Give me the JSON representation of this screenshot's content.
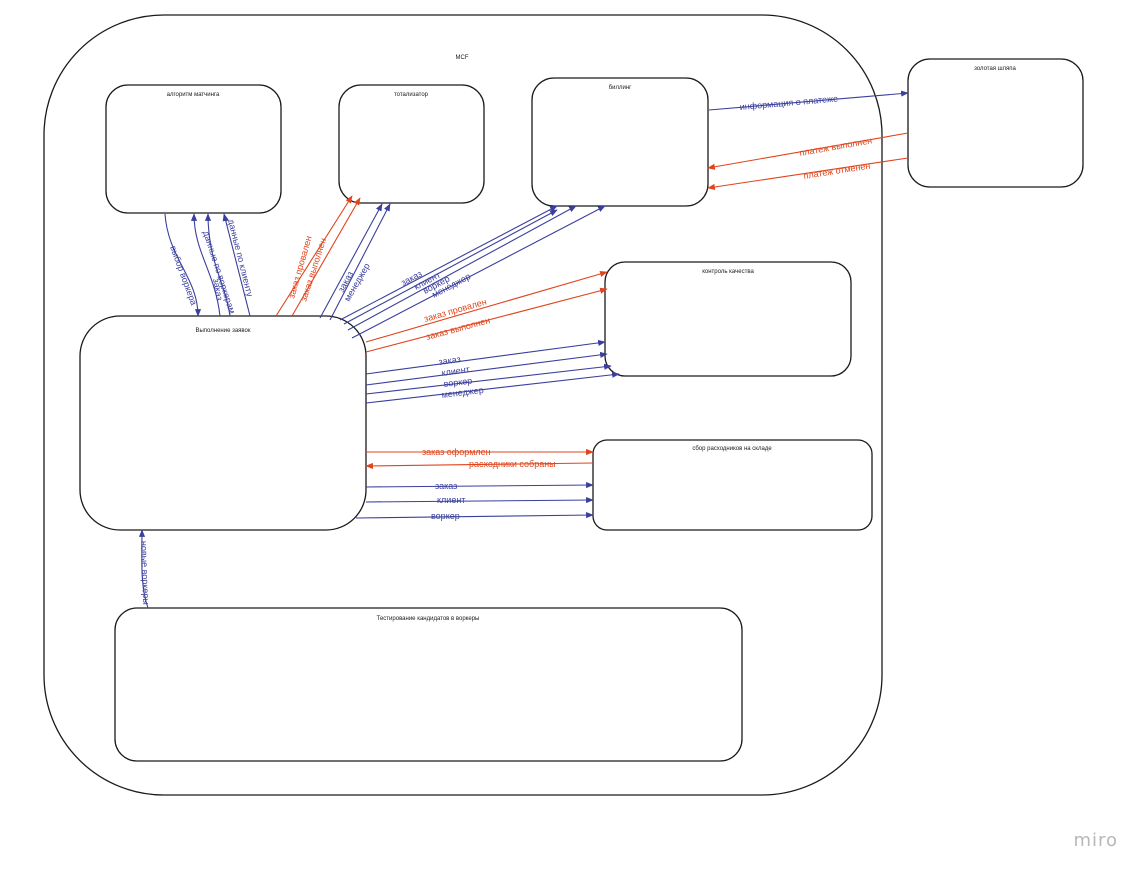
{
  "colors": {
    "blue": "#3a3f9c",
    "red": "#e0441c",
    "border": "#1a1a1a",
    "logo": "#b8b8b8"
  },
  "brand": {
    "logo_text": "miro"
  },
  "container": {
    "label": "МСF"
  },
  "nodes": {
    "matching": "алгоритм матчинга",
    "totalizator": "тотализатор",
    "billing": "биллинг",
    "golden_hat": "золотая шляпа",
    "orders": "Выполнение заявок",
    "quality": "контроль качества",
    "warehouse": "сбор расходников на складе",
    "testing": "Тестирование кандидатов в воркеры"
  },
  "edges": {
    "worker_pick": "выбор воркера",
    "worker_data": "данные по воркерам",
    "order_to_matching": "заказ",
    "client_data": "данные по клиенту",
    "tot_failed": "заказ провален",
    "tot_done": "заказ выполнен",
    "tot_order": "заказ",
    "tot_manager": "менеджер",
    "bill_order": "заказ",
    "bill_client": "клиент",
    "bill_worker": "воркер",
    "bill_manager": "менеджер",
    "payment_info": "информация о платеже",
    "payment_done": "платеж выполнен",
    "payment_cancelled": "платеж отменен",
    "qc_failed": "заказ провален",
    "qc_done": "заказ выполнен",
    "qc_order": "заказ",
    "qc_client": "клиент",
    "qc_worker": "воркер",
    "qc_manager": "менеджер",
    "wh_order_placed": "заказ оформлен",
    "wh_supplies": "расходники собраны",
    "wh_order": "заказ",
    "wh_client": "клиент",
    "wh_worker": "воркер",
    "new_workers": "новые воркеры"
  }
}
